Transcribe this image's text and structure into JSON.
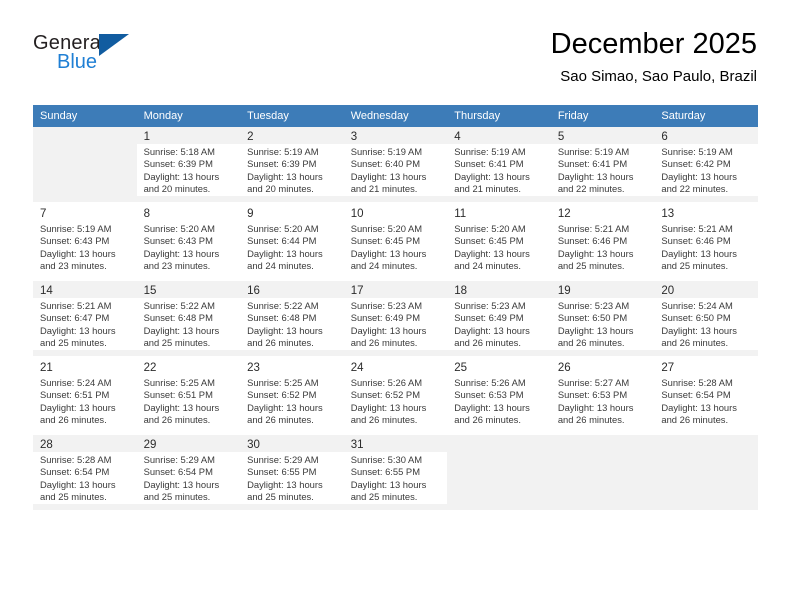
{
  "brand": {
    "name_part1": "General",
    "name_part2": "Blue",
    "triangle_color": "#115ca0",
    "blue_color": "#1f7fd4"
  },
  "header": {
    "title": "December 2025",
    "subtitle": "Sao Simao, Sao Paulo, Brazil"
  },
  "theme": {
    "header_row_bg": "#3d7cb8",
    "shaded_row_bg": "#f2f2f2",
    "cell_bg": "#ffffff"
  },
  "weekday_headers": [
    "Sunday",
    "Monday",
    "Tuesday",
    "Wednesday",
    "Thursday",
    "Friday",
    "Saturday"
  ],
  "weeks": [
    {
      "days": [
        {
          "num": "",
          "sunrise": "",
          "sunset": "",
          "daylight_line1": "",
          "daylight_line2": ""
        },
        {
          "num": "1",
          "sunrise": "Sunrise: 5:18 AM",
          "sunset": "Sunset: 6:39 PM",
          "daylight_line1": "Daylight: 13 hours",
          "daylight_line2": "and 20 minutes."
        },
        {
          "num": "2",
          "sunrise": "Sunrise: 5:19 AM",
          "sunset": "Sunset: 6:39 PM",
          "daylight_line1": "Daylight: 13 hours",
          "daylight_line2": "and 20 minutes."
        },
        {
          "num": "3",
          "sunrise": "Sunrise: 5:19 AM",
          "sunset": "Sunset: 6:40 PM",
          "daylight_line1": "Daylight: 13 hours",
          "daylight_line2": "and 21 minutes."
        },
        {
          "num": "4",
          "sunrise": "Sunrise: 5:19 AM",
          "sunset": "Sunset: 6:41 PM",
          "daylight_line1": "Daylight: 13 hours",
          "daylight_line2": "and 21 minutes."
        },
        {
          "num": "5",
          "sunrise": "Sunrise: 5:19 AM",
          "sunset": "Sunset: 6:41 PM",
          "daylight_line1": "Daylight: 13 hours",
          "daylight_line2": "and 22 minutes."
        },
        {
          "num": "6",
          "sunrise": "Sunrise: 5:19 AM",
          "sunset": "Sunset: 6:42 PM",
          "daylight_line1": "Daylight: 13 hours",
          "daylight_line2": "and 22 minutes."
        }
      ]
    },
    {
      "days": [
        {
          "num": "7",
          "sunrise": "Sunrise: 5:19 AM",
          "sunset": "Sunset: 6:43 PM",
          "daylight_line1": "Daylight: 13 hours",
          "daylight_line2": "and 23 minutes."
        },
        {
          "num": "8",
          "sunrise": "Sunrise: 5:20 AM",
          "sunset": "Sunset: 6:43 PM",
          "daylight_line1": "Daylight: 13 hours",
          "daylight_line2": "and 23 minutes."
        },
        {
          "num": "9",
          "sunrise": "Sunrise: 5:20 AM",
          "sunset": "Sunset: 6:44 PM",
          "daylight_line1": "Daylight: 13 hours",
          "daylight_line2": "and 24 minutes."
        },
        {
          "num": "10",
          "sunrise": "Sunrise: 5:20 AM",
          "sunset": "Sunset: 6:45 PM",
          "daylight_line1": "Daylight: 13 hours",
          "daylight_line2": "and 24 minutes."
        },
        {
          "num": "11",
          "sunrise": "Sunrise: 5:20 AM",
          "sunset": "Sunset: 6:45 PM",
          "daylight_line1": "Daylight: 13 hours",
          "daylight_line2": "and 24 minutes."
        },
        {
          "num": "12",
          "sunrise": "Sunrise: 5:21 AM",
          "sunset": "Sunset: 6:46 PM",
          "daylight_line1": "Daylight: 13 hours",
          "daylight_line2": "and 25 minutes."
        },
        {
          "num": "13",
          "sunrise": "Sunrise: 5:21 AM",
          "sunset": "Sunset: 6:46 PM",
          "daylight_line1": "Daylight: 13 hours",
          "daylight_line2": "and 25 minutes."
        }
      ]
    },
    {
      "days": [
        {
          "num": "14",
          "sunrise": "Sunrise: 5:21 AM",
          "sunset": "Sunset: 6:47 PM",
          "daylight_line1": "Daylight: 13 hours",
          "daylight_line2": "and 25 minutes."
        },
        {
          "num": "15",
          "sunrise": "Sunrise: 5:22 AM",
          "sunset": "Sunset: 6:48 PM",
          "daylight_line1": "Daylight: 13 hours",
          "daylight_line2": "and 25 minutes."
        },
        {
          "num": "16",
          "sunrise": "Sunrise: 5:22 AM",
          "sunset": "Sunset: 6:48 PM",
          "daylight_line1": "Daylight: 13 hours",
          "daylight_line2": "and 26 minutes."
        },
        {
          "num": "17",
          "sunrise": "Sunrise: 5:23 AM",
          "sunset": "Sunset: 6:49 PM",
          "daylight_line1": "Daylight: 13 hours",
          "daylight_line2": "and 26 minutes."
        },
        {
          "num": "18",
          "sunrise": "Sunrise: 5:23 AM",
          "sunset": "Sunset: 6:49 PM",
          "daylight_line1": "Daylight: 13 hours",
          "daylight_line2": "and 26 minutes."
        },
        {
          "num": "19",
          "sunrise": "Sunrise: 5:23 AM",
          "sunset": "Sunset: 6:50 PM",
          "daylight_line1": "Daylight: 13 hours",
          "daylight_line2": "and 26 minutes."
        },
        {
          "num": "20",
          "sunrise": "Sunrise: 5:24 AM",
          "sunset": "Sunset: 6:50 PM",
          "daylight_line1": "Daylight: 13 hours",
          "daylight_line2": "and 26 minutes."
        }
      ]
    },
    {
      "days": [
        {
          "num": "21",
          "sunrise": "Sunrise: 5:24 AM",
          "sunset": "Sunset: 6:51 PM",
          "daylight_line1": "Daylight: 13 hours",
          "daylight_line2": "and 26 minutes."
        },
        {
          "num": "22",
          "sunrise": "Sunrise: 5:25 AM",
          "sunset": "Sunset: 6:51 PM",
          "daylight_line1": "Daylight: 13 hours",
          "daylight_line2": "and 26 minutes."
        },
        {
          "num": "23",
          "sunrise": "Sunrise: 5:25 AM",
          "sunset": "Sunset: 6:52 PM",
          "daylight_line1": "Daylight: 13 hours",
          "daylight_line2": "and 26 minutes."
        },
        {
          "num": "24",
          "sunrise": "Sunrise: 5:26 AM",
          "sunset": "Sunset: 6:52 PM",
          "daylight_line1": "Daylight: 13 hours",
          "daylight_line2": "and 26 minutes."
        },
        {
          "num": "25",
          "sunrise": "Sunrise: 5:26 AM",
          "sunset": "Sunset: 6:53 PM",
          "daylight_line1": "Daylight: 13 hours",
          "daylight_line2": "and 26 minutes."
        },
        {
          "num": "26",
          "sunrise": "Sunrise: 5:27 AM",
          "sunset": "Sunset: 6:53 PM",
          "daylight_line1": "Daylight: 13 hours",
          "daylight_line2": "and 26 minutes."
        },
        {
          "num": "27",
          "sunrise": "Sunrise: 5:28 AM",
          "sunset": "Sunset: 6:54 PM",
          "daylight_line1": "Daylight: 13 hours",
          "daylight_line2": "and 26 minutes."
        }
      ]
    },
    {
      "days": [
        {
          "num": "28",
          "sunrise": "Sunrise: 5:28 AM",
          "sunset": "Sunset: 6:54 PM",
          "daylight_line1": "Daylight: 13 hours",
          "daylight_line2": "and 25 minutes."
        },
        {
          "num": "29",
          "sunrise": "Sunrise: 5:29 AM",
          "sunset": "Sunset: 6:54 PM",
          "daylight_line1": "Daylight: 13 hours",
          "daylight_line2": "and 25 minutes."
        },
        {
          "num": "30",
          "sunrise": "Sunrise: 5:29 AM",
          "sunset": "Sunset: 6:55 PM",
          "daylight_line1": "Daylight: 13 hours",
          "daylight_line2": "and 25 minutes."
        },
        {
          "num": "31",
          "sunrise": "Sunrise: 5:30 AM",
          "sunset": "Sunset: 6:55 PM",
          "daylight_line1": "Daylight: 13 hours",
          "daylight_line2": "and 25 minutes."
        },
        {
          "num": "",
          "sunrise": "",
          "sunset": "",
          "daylight_line1": "",
          "daylight_line2": ""
        },
        {
          "num": "",
          "sunrise": "",
          "sunset": "",
          "daylight_line1": "",
          "daylight_line2": ""
        },
        {
          "num": "",
          "sunrise": "",
          "sunset": "",
          "daylight_line1": "",
          "daylight_line2": ""
        }
      ]
    }
  ]
}
